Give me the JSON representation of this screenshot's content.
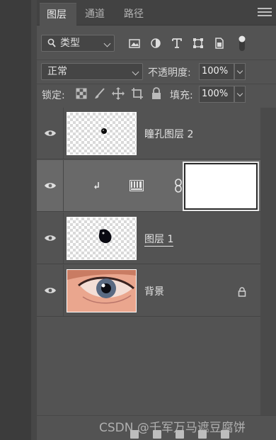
{
  "tabs": [
    {
      "label": "图层",
      "active": true
    },
    {
      "label": "通道",
      "active": false
    },
    {
      "label": "路径",
      "active": false
    }
  ],
  "filter": {
    "kind_label": "类型",
    "icons": [
      "image-filter-icon",
      "adjustment-filter-icon",
      "type-filter-icon",
      "shape-filter-icon",
      "smart-object-filter-icon",
      "filter-toggle-icon"
    ]
  },
  "blend": {
    "mode": "正常",
    "opacity_label": "不透明度:",
    "opacity_value": "100%"
  },
  "lock": {
    "label": "锁定:",
    "fill_label": "填充:",
    "fill_value": "100%",
    "icons": [
      "lock-transparent-pixels-icon",
      "lock-image-pixels-icon",
      "lock-position-icon",
      "lock-artboard-icon",
      "lock-all-icon"
    ]
  },
  "layers": [
    {
      "name": "瞳孔图层 2",
      "type": "pixel",
      "visible": true,
      "selected": false
    },
    {
      "name": "",
      "type": "adjustment-levels",
      "visible": true,
      "selected": true,
      "clipped": true
    },
    {
      "name": "图层 1",
      "type": "pixel",
      "visible": true,
      "selected": false
    },
    {
      "name": "背景",
      "type": "background",
      "visible": true,
      "selected": false,
      "locked": true
    }
  ],
  "watermark": "CSDN @千军万马遮豆腐饼",
  "colors": {
    "panel": "#535353",
    "tabbar": "#424242",
    "selected_row": "#696969"
  }
}
